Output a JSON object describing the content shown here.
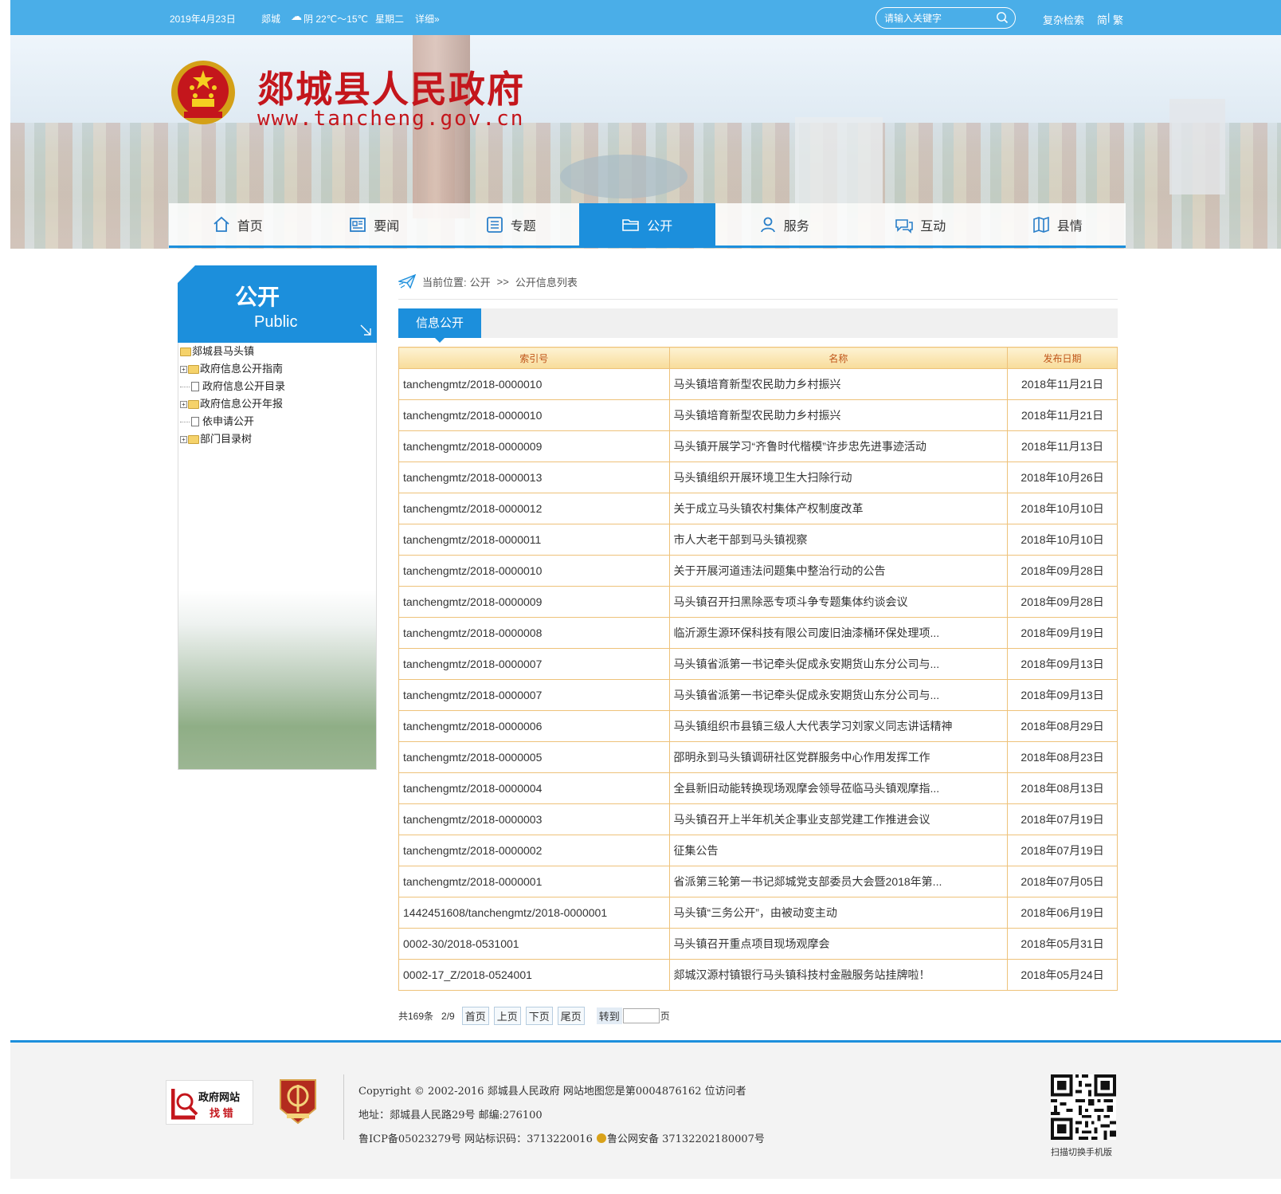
{
  "topbar": {
    "date": "2019年4月23日",
    "city": "郯城",
    "weather": "阴 22℃～15℃",
    "weekday": "星期二",
    "detail_link": "详细»",
    "search_placeholder": "请输入关键字",
    "advanced_search": "复杂检索",
    "lang_simplified": "简",
    "lang_separator": "|",
    "lang_traditional": "繁"
  },
  "banner": {
    "site_name": "郯城县人民政府",
    "site_url": "www.tancheng.gov.cn"
  },
  "nav": {
    "items": [
      {
        "label": "首页",
        "icon": "home-icon"
      },
      {
        "label": "要闻",
        "icon": "newspaper-icon"
      },
      {
        "label": "专题",
        "icon": "list-icon"
      },
      {
        "label": "公开",
        "icon": "folder-icon"
      },
      {
        "label": "服务",
        "icon": "user-icon"
      },
      {
        "label": "互动",
        "icon": "chat-icon"
      },
      {
        "label": "县情",
        "icon": "map-icon"
      }
    ],
    "active_color": "#1c8fdc"
  },
  "sidebar": {
    "title": "公开",
    "subtitle": "Public",
    "tree": [
      {
        "label": "郯城县马头镇"
      },
      {
        "label": "政府信息公开指南"
      },
      {
        "label": "政府信息公开目录"
      },
      {
        "label": "政府信息公开年报"
      },
      {
        "label": "依申请公开"
      },
      {
        "label": "部门目录树"
      }
    ]
  },
  "breadcrumb": {
    "prefix": "当前位置:",
    "level1": "公开",
    "separator": ">>",
    "level2": "公开信息列表"
  },
  "tab": {
    "label": "信息公开"
  },
  "table": {
    "headers": {
      "index": "索引号",
      "name": "名称",
      "date": "发布日期"
    },
    "rows": [
      {
        "index": "tanchengmtz/2018-0000010",
        "name": "马头镇培育新型农民助力乡村振兴",
        "date": "2018年11月21日"
      },
      {
        "index": "tanchengmtz/2018-0000010",
        "name": "马头镇培育新型农民助力乡村振兴",
        "date": "2018年11月21日"
      },
      {
        "index": "tanchengmtz/2018-0000009",
        "name": "马头镇开展学习“齐鲁时代楷模”许步忠先进事迹活动",
        "date": "2018年11月13日"
      },
      {
        "index": "tanchengmtz/2018-0000013",
        "name": "马头镇组织开展环境卫生大扫除行动",
        "date": "2018年10月26日"
      },
      {
        "index": "tanchengmtz/2018-0000012",
        "name": "关于成立马头镇农村集体产权制度改革",
        "date": "2018年10月10日"
      },
      {
        "index": "tanchengmtz/2018-0000011",
        "name": "市人大老干部到马头镇视察",
        "date": "2018年10月10日"
      },
      {
        "index": "tanchengmtz/2018-0000010",
        "name": "关于开展河道违法问题集中整治行动的公告",
        "date": "2018年09月28日"
      },
      {
        "index": "tanchengmtz/2018-0000009",
        "name": "马头镇召开扫黑除恶专项斗争专题集体约谈会议",
        "date": "2018年09月28日"
      },
      {
        "index": "tanchengmtz/2018-0000008",
        "name": "临沂源生源环保科技有限公司废旧油漆桶环保处理项...",
        "date": "2018年09月19日"
      },
      {
        "index": "tanchengmtz/2018-0000007",
        "name": "马头镇省派第一书记牵头促成永安期货山东分公司与...",
        "date": "2018年09月13日"
      },
      {
        "index": "tanchengmtz/2018-0000007",
        "name": "马头镇省派第一书记牵头促成永安期货山东分公司与...",
        "date": "2018年09月13日"
      },
      {
        "index": "tanchengmtz/2018-0000006",
        "name": "马头镇组织市县镇三级人大代表学习刘家义同志讲话精神",
        "date": "2018年08月29日"
      },
      {
        "index": "tanchengmtz/2018-0000005",
        "name": "邵明永到马头镇调研社区党群服务中心作用发挥工作",
        "date": "2018年08月23日"
      },
      {
        "index": "tanchengmtz/2018-0000004",
        "name": "全县新旧动能转换现场观摩会领导莅临马头镇观摩指...",
        "date": "2018年08月13日"
      },
      {
        "index": "tanchengmtz/2018-0000003",
        "name": "马头镇召开上半年机关企事业支部党建工作推进会议",
        "date": "2018年07月19日"
      },
      {
        "index": "tanchengmtz/2018-0000002",
        "name": "征集公告",
        "date": "2018年07月19日"
      },
      {
        "index": "tanchengmtz/2018-0000001",
        "name": "省派第三轮第一书记郯城党支部委员大会暨2018年第...",
        "date": "2018年07月05日"
      },
      {
        "index": "1442451608/tanchengmtz/2018-0000001",
        "name": "马头镇“三务公开”，由被动变主动",
        "date": "2018年06月19日"
      },
      {
        "index": "0002-30/2018-0531001",
        "name": "马头镇召开重点项目现场观摩会",
        "date": "2018年05月31日"
      },
      {
        "index": "0002-17_Z/2018-0524001",
        "name": "郯城汉源村镇银行马头镇科技村金融服务站挂牌啦！",
        "date": "2018年05月24日"
      }
    ]
  },
  "pager": {
    "total": "共169条",
    "page": "2/9",
    "first": "首页",
    "prev": "上页",
    "next": "下页",
    "last": "尾页",
    "goto": "转到",
    "goto_value": "",
    "page_suffix": "页"
  },
  "footer": {
    "find_error_line1": "政府网站",
    "find_error_line2": "找 错",
    "copyright": "Copyright © 2002-2016 郯城县人民政府  网站地图您是第0004876162 位访问者",
    "address": "地址：郯城县人民路29号 邮编:276100",
    "icp": "鲁ICP备05023279号  网站标识码：3713220016",
    "police": "鲁公网安备 37132202180007号",
    "qr_caption": "扫描切换手机版"
  }
}
